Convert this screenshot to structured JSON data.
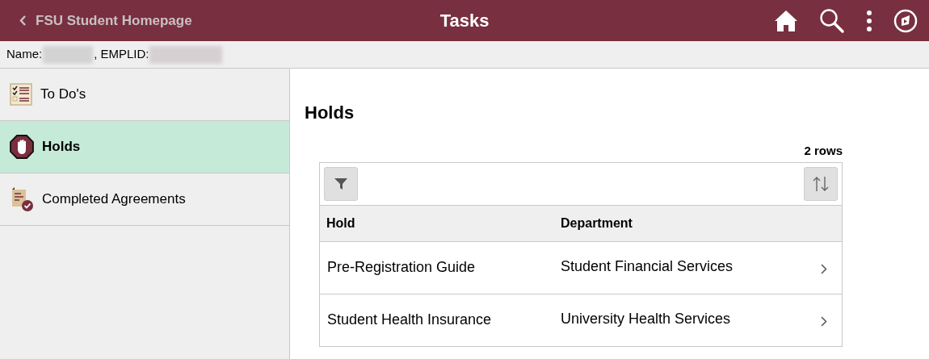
{
  "header": {
    "back_label": "FSU Student Homepage",
    "title": "Tasks"
  },
  "identity": {
    "name_label": "Name:",
    "emplid_label": ", EMPLID:"
  },
  "sidebar": {
    "items": [
      {
        "label": "To Do's",
        "kind": "todo",
        "selected": false
      },
      {
        "label": "Holds",
        "kind": "hold",
        "selected": true
      },
      {
        "label": "Completed Agreements",
        "kind": "agreement",
        "selected": false
      }
    ]
  },
  "content": {
    "title": "Holds",
    "row_count": "2 rows",
    "table": {
      "columns": [
        "Hold",
        "Department"
      ],
      "rows": [
        {
          "hold": "Pre-Registration Guide",
          "department": "Student Financial Services"
        },
        {
          "hold": "Student Health Insurance",
          "department": "University Health Services"
        }
      ]
    }
  }
}
